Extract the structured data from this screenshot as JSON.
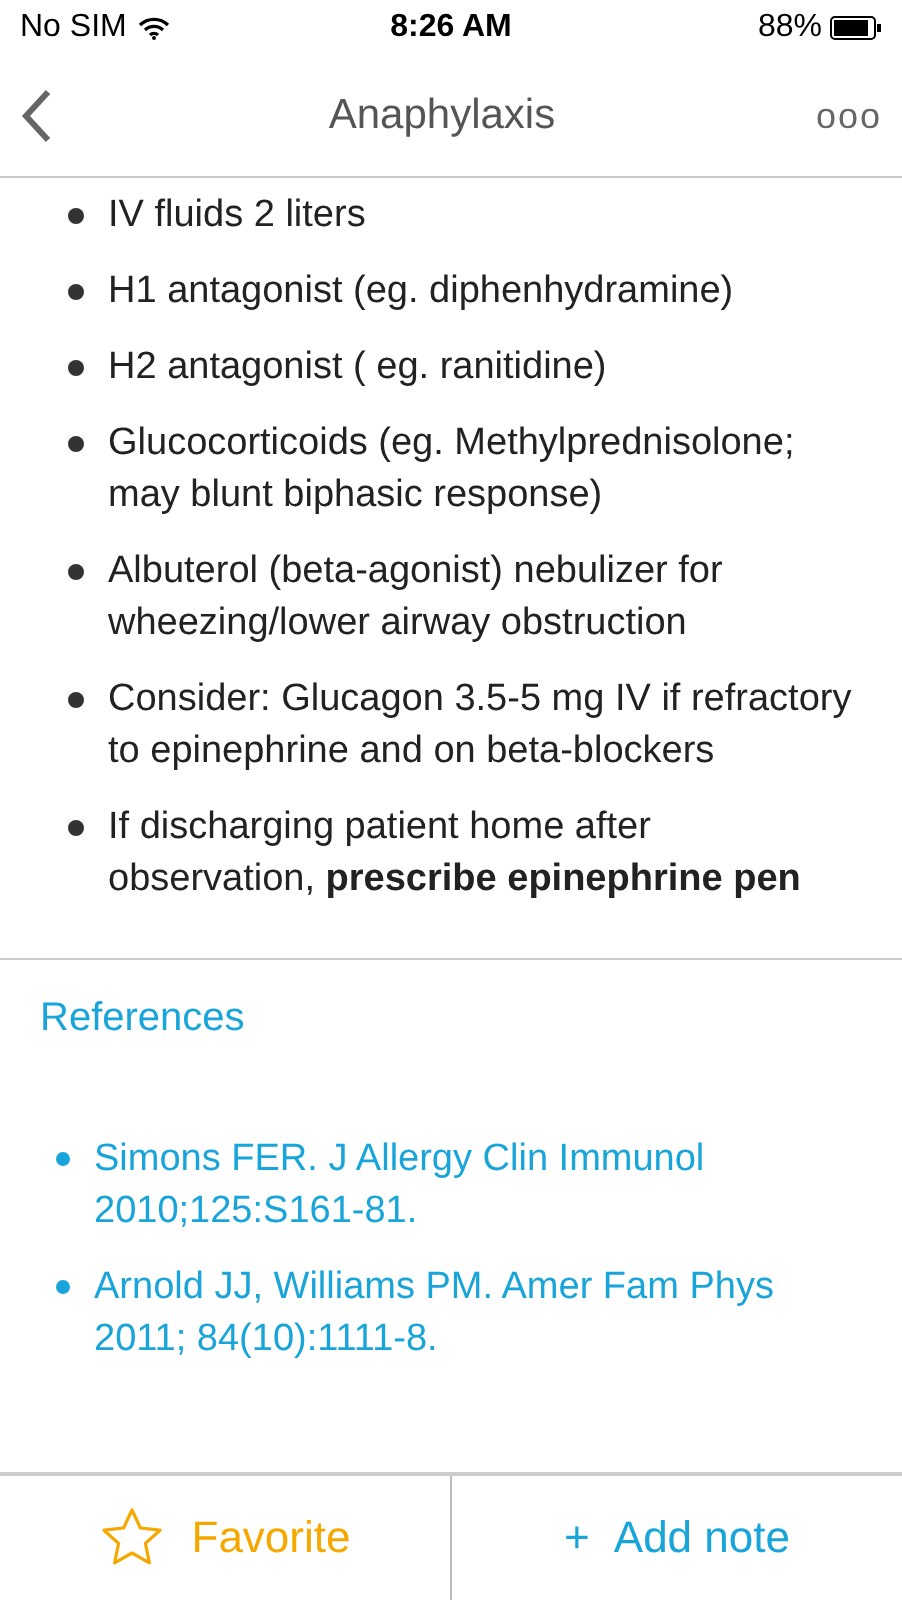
{
  "status_bar": {
    "carrier": "No SIM",
    "time": "8:26 AM",
    "battery": "88%"
  },
  "nav": {
    "title": "Anaphylaxis",
    "more": "ooo"
  },
  "bullets": [
    "IV fluids 2 liters",
    "H1 antagonist (eg. diphenhydramine)",
    "H2 antagonist ( eg. ranitidine)",
    "Glucocorticoids (eg. Methylprednisolone; may blunt biphasic response)",
    "Albuterol (beta-agonist) nebulizer for wheezing/lower airway obstruction",
    "Consider: Glucagon 3.5-5 mg IV if refractory to epinephrine and on beta-blockers",
    "If discharging patient home after observation, **prescribe epinephrine pen**"
  ],
  "references": {
    "heading": "References",
    "items": [
      "Simons FER. J Allergy Clin Immunol 2010;125:S161-81.",
      "Arnold JJ, Williams PM. Amer Fam Phys 2011; 84(10):1111-8."
    ]
  },
  "toolbar": {
    "favorite": {
      "label": "Favorite",
      "selected": false
    },
    "add_note": {
      "plus": "+",
      "label": "Add note"
    }
  }
}
